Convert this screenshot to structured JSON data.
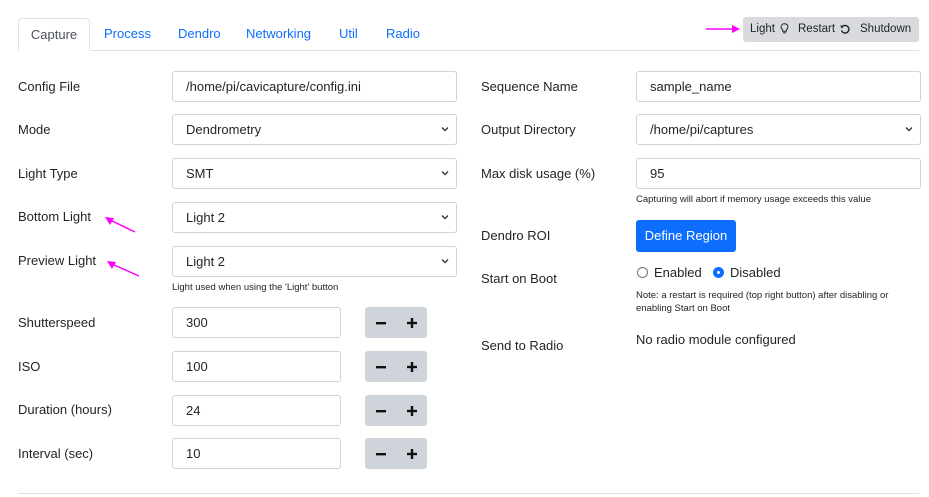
{
  "tabs": [
    "Capture",
    "Process",
    "Dendro",
    "Networking",
    "Util",
    "Radio"
  ],
  "toolbar": {
    "light_label": "Light",
    "light_icon": "lightbulb-icon",
    "restart_label": "Restart",
    "restart_icon": "restart-icon",
    "shutdown_label": "Shutdown"
  },
  "left": {
    "config_file": {
      "label": "Config File",
      "value": "/home/pi/cavicapture/config.ini"
    },
    "mode": {
      "label": "Mode",
      "value": "Dendrometry"
    },
    "light_type": {
      "label": "Light Type",
      "value": "SMT"
    },
    "bottom_light": {
      "label": "Bottom Light",
      "value": "Light 2"
    },
    "preview_light": {
      "label": "Preview Light",
      "value": "Light 2",
      "help": "Light used when using the 'Light' button"
    },
    "shutterspeed": {
      "label": "Shutterspeed",
      "value": "300"
    },
    "iso": {
      "label": "ISO",
      "value": "100"
    },
    "duration": {
      "label": "Duration (hours)",
      "value": "24"
    },
    "interval": {
      "label": "Interval (sec)",
      "value": "10"
    }
  },
  "right": {
    "sequence_name": {
      "label": "Sequence Name",
      "value": "sample_name"
    },
    "output_directory": {
      "label": "Output Directory",
      "value": "/home/pi/captures"
    },
    "max_disk": {
      "label": "Max disk usage (%)",
      "value": "95",
      "help": "Capturing will abort if memory usage exceeds this value"
    },
    "dendro_roi": {
      "label": "Dendro ROI",
      "button": "Define Region"
    },
    "start_on_boot": {
      "label": "Start on Boot",
      "options": [
        "Enabled",
        "Disabled"
      ],
      "selected": "Disabled",
      "note": "Note: a restart is required (top right button) after disabling or enabling Start on Boot"
    },
    "send_to_radio": {
      "label": "Send to Radio",
      "value": "No radio module configured"
    }
  },
  "colors": {
    "accent": "#0d6efd",
    "annotation_arrow": "#ff00ff",
    "button_group_bg": "#d8dadd"
  }
}
